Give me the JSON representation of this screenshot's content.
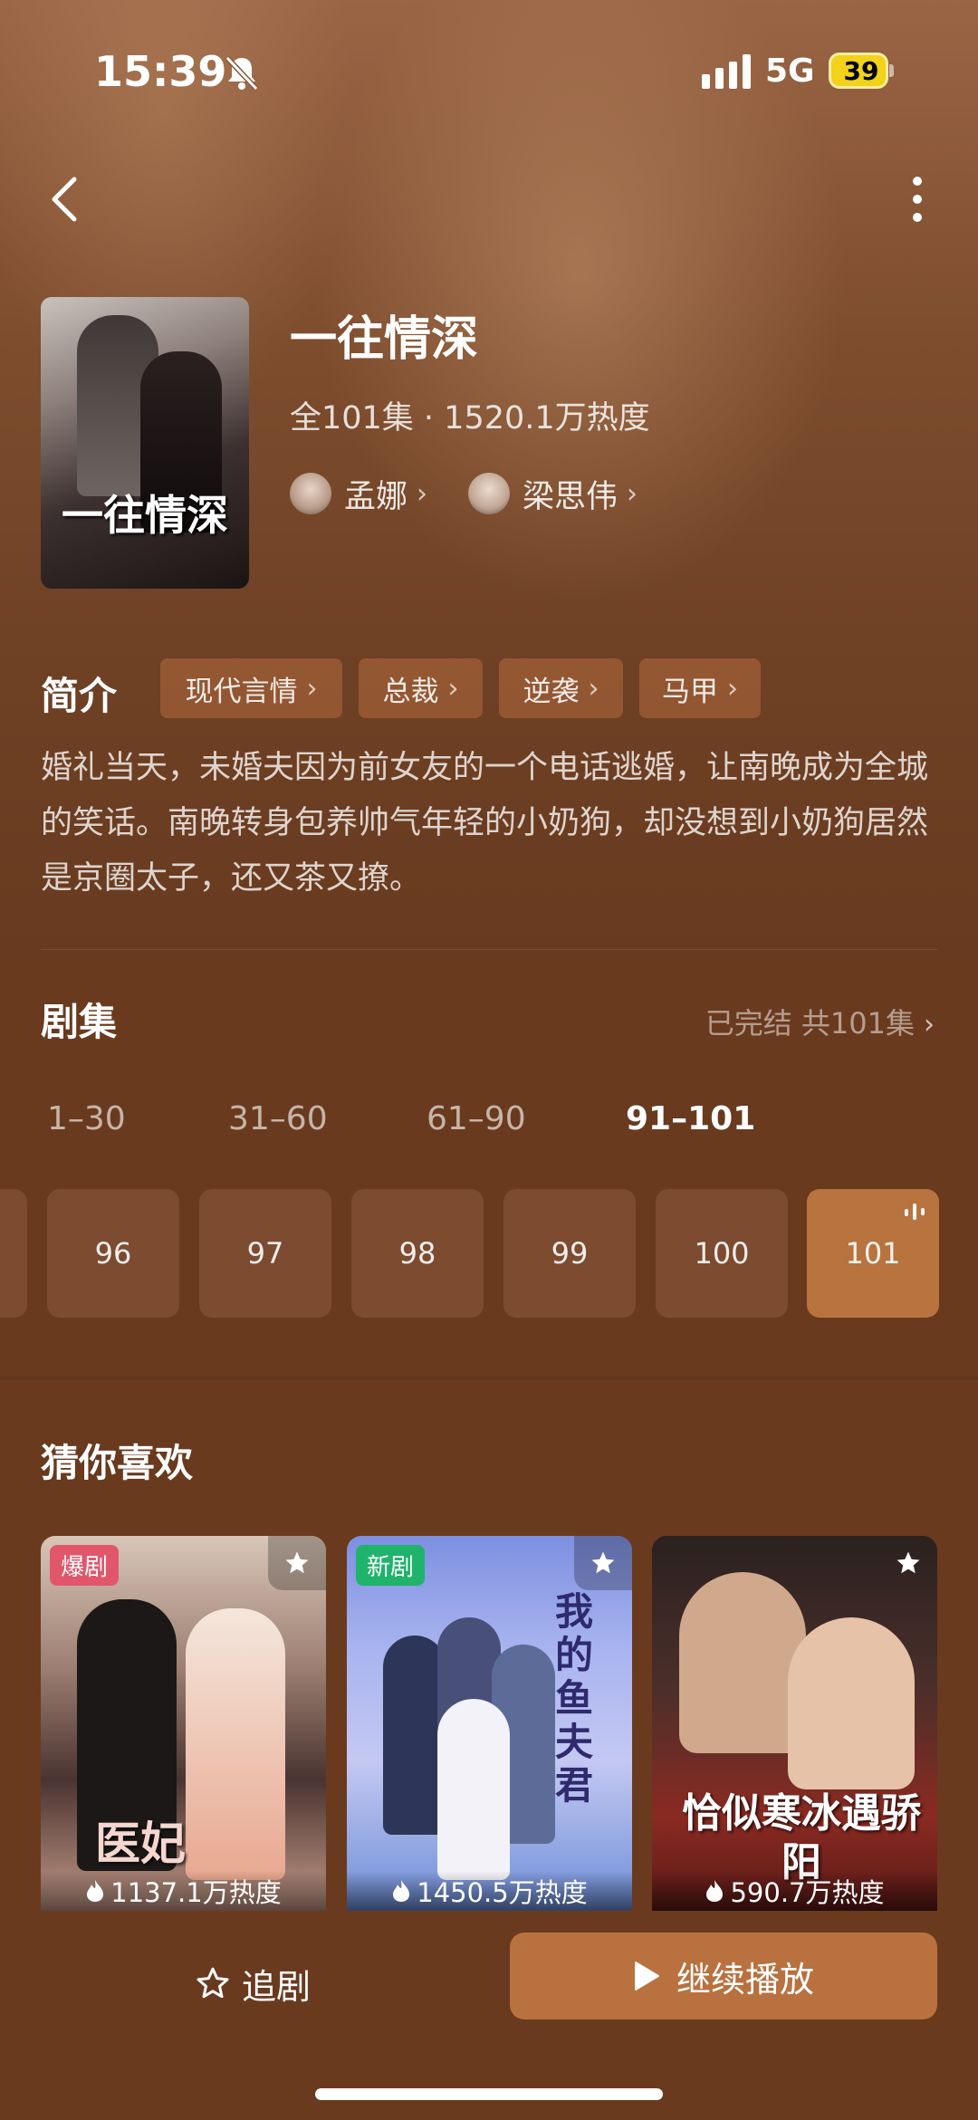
{
  "status_bar": {
    "time": "15:39",
    "network": "5G",
    "battery": "39"
  },
  "drama": {
    "title": "一往情深",
    "meta": "全101集 · 1520.1万热度",
    "poster_title": "一往情深",
    "actors": [
      {
        "name": "孟娜"
      },
      {
        "name": "梁思伟"
      }
    ]
  },
  "intro": {
    "label": "简介",
    "tags": [
      "现代言情",
      "总裁",
      "逆袭",
      "马甲"
    ],
    "synopsis": "婚礼当天，未婚夫因为前女友的一个电话逃婚，让南晚成为全城的笑话。南晚转身包养帅气年轻的小奶狗，却没想到小奶狗居然是京圈太子，还又茶又撩。"
  },
  "episodes": {
    "label": "剧集",
    "status": "已完结 共101集",
    "ranges": [
      "1–30",
      "31–60",
      "61–90",
      "91–101"
    ],
    "active_range": "91–101",
    "items": [
      "96",
      "97",
      "98",
      "99",
      "100",
      "101"
    ],
    "current": "101"
  },
  "recommend": {
    "label": "猜你喜欢",
    "cards": [
      {
        "badge": "爆剧",
        "badge_color": "#e2566b",
        "heat": "1137.1万热度",
        "poster_text": "医妃"
      },
      {
        "badge": "新剧",
        "badge_color": "#1fb36b",
        "heat": "1450.5万热度",
        "poster_text": "我的鱼夫君"
      },
      {
        "badge": "",
        "heat": "590.7万热度",
        "poster_text": "恰似寒冰遇骄阳"
      }
    ]
  },
  "bottom": {
    "follow_label": "追剧",
    "play_label": "继续播放"
  },
  "colors": {
    "accent": "#b8713f",
    "background": "#6a3a1f"
  }
}
